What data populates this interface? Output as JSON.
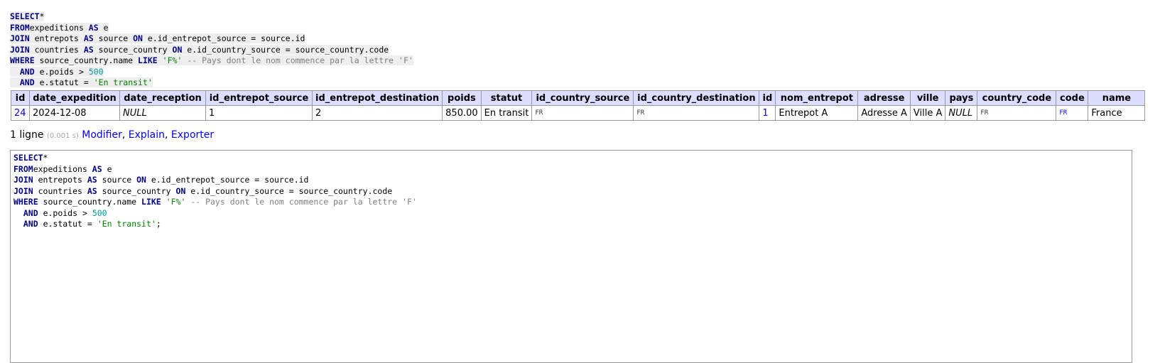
{
  "query_lines": [
    [
      [
        "kw",
        "SELECT"
      ],
      [
        "",
        "*"
      ]
    ],
    [
      [
        "kw",
        "FROM"
      ],
      [
        "",
        "expeditions "
      ],
      [
        "kw",
        "AS"
      ],
      [
        "",
        " e"
      ]
    ],
    [
      [
        "kw",
        "JOIN"
      ],
      [
        "",
        " entrepots "
      ],
      [
        "kw",
        "AS"
      ],
      [
        "",
        " source "
      ],
      [
        "kw",
        "ON"
      ],
      [
        "",
        " e.id_entrepot_source = source.id"
      ]
    ],
    [
      [
        "kw",
        "JOIN"
      ],
      [
        "",
        " countries "
      ],
      [
        "kw",
        "AS"
      ],
      [
        "",
        " source_country "
      ],
      [
        "kw",
        "ON"
      ],
      [
        "",
        " e.id_country_source = source_country.code"
      ]
    ],
    [
      [
        "kw",
        "WHERE"
      ],
      [
        "",
        " source_country.name "
      ],
      [
        "kw",
        "LIKE"
      ],
      [
        "",
        " "
      ],
      [
        "st",
        "'F%'"
      ],
      [
        "",
        " "
      ],
      [
        "cm",
        "-- Pays dont le nom commence par la lettre 'F'"
      ]
    ],
    [
      [
        "",
        "  "
      ],
      [
        "kw",
        "AND"
      ],
      [
        "",
        " e.poids > "
      ],
      [
        "nu",
        "500"
      ]
    ],
    [
      [
        "",
        "  "
      ],
      [
        "kw",
        "AND"
      ],
      [
        "",
        " e.statut = "
      ],
      [
        "st",
        "'En transit'"
      ]
    ]
  ],
  "editor_suffix": ";",
  "result_table": {
    "columns": [
      "id",
      "date_expedition",
      "date_reception",
      "id_entrepot_source",
      "id_entrepot_destination",
      "poids",
      "statut",
      "id_country_source",
      "id_country_destination",
      "id",
      "nom_entrepot",
      "adresse",
      "ville",
      "pays",
      "country_code",
      "code",
      "name"
    ],
    "rows": [
      [
        "24",
        "2024-12-08",
        "NULL",
        "1",
        "2",
        "850.00",
        "En transit",
        "FR",
        "FR",
        "1",
        "Entrepot A",
        "Adresse A",
        "Ville A",
        "NULL",
        "FR",
        "FR",
        "France"
      ]
    ]
  },
  "info": {
    "count": "1 ligne",
    "time": "(0.001 s)",
    "links": [
      "Modifier",
      "Explain",
      "Exporter"
    ]
  },
  "colors": {
    "header_bg": "#ddf",
    "link": "#00f",
    "keyword": "#000080",
    "string": "#008000"
  }
}
